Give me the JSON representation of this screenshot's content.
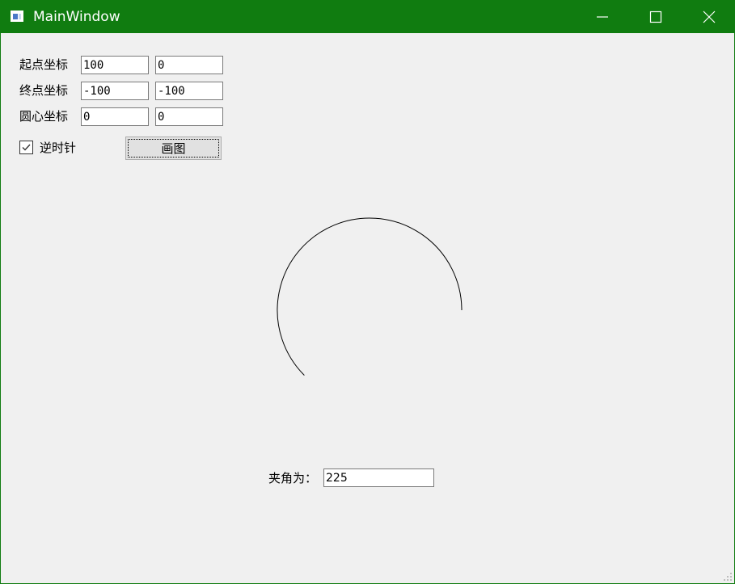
{
  "window": {
    "title": "MainWindow",
    "accent_color": "#107c10",
    "title_text_color": "#ffffff"
  },
  "controls": {
    "start_label": "起点坐标",
    "start_x": "100",
    "start_y": "0",
    "end_label": "终点坐标",
    "end_x": "-100",
    "end_y": "-100",
    "center_label": "圆心坐标",
    "center_x": "0",
    "center_y": "0",
    "ccw_label": "逆时针",
    "ccw_checked": true,
    "draw_button_label": "画图"
  },
  "arc": {
    "radius": 114,
    "start_angle_deg": 0,
    "sweep_deg": 225,
    "direction": "counterclockwise",
    "stroke_color": "#000000"
  },
  "result": {
    "angle_label": "夹角为：",
    "angle_value": "225"
  },
  "icons": {
    "app": "app-window-icon",
    "minimize": "minimize-icon",
    "maximize": "maximize-icon",
    "close": "close-icon",
    "checkmark": "checkmark-icon",
    "resize": "resize-grip-icon"
  }
}
